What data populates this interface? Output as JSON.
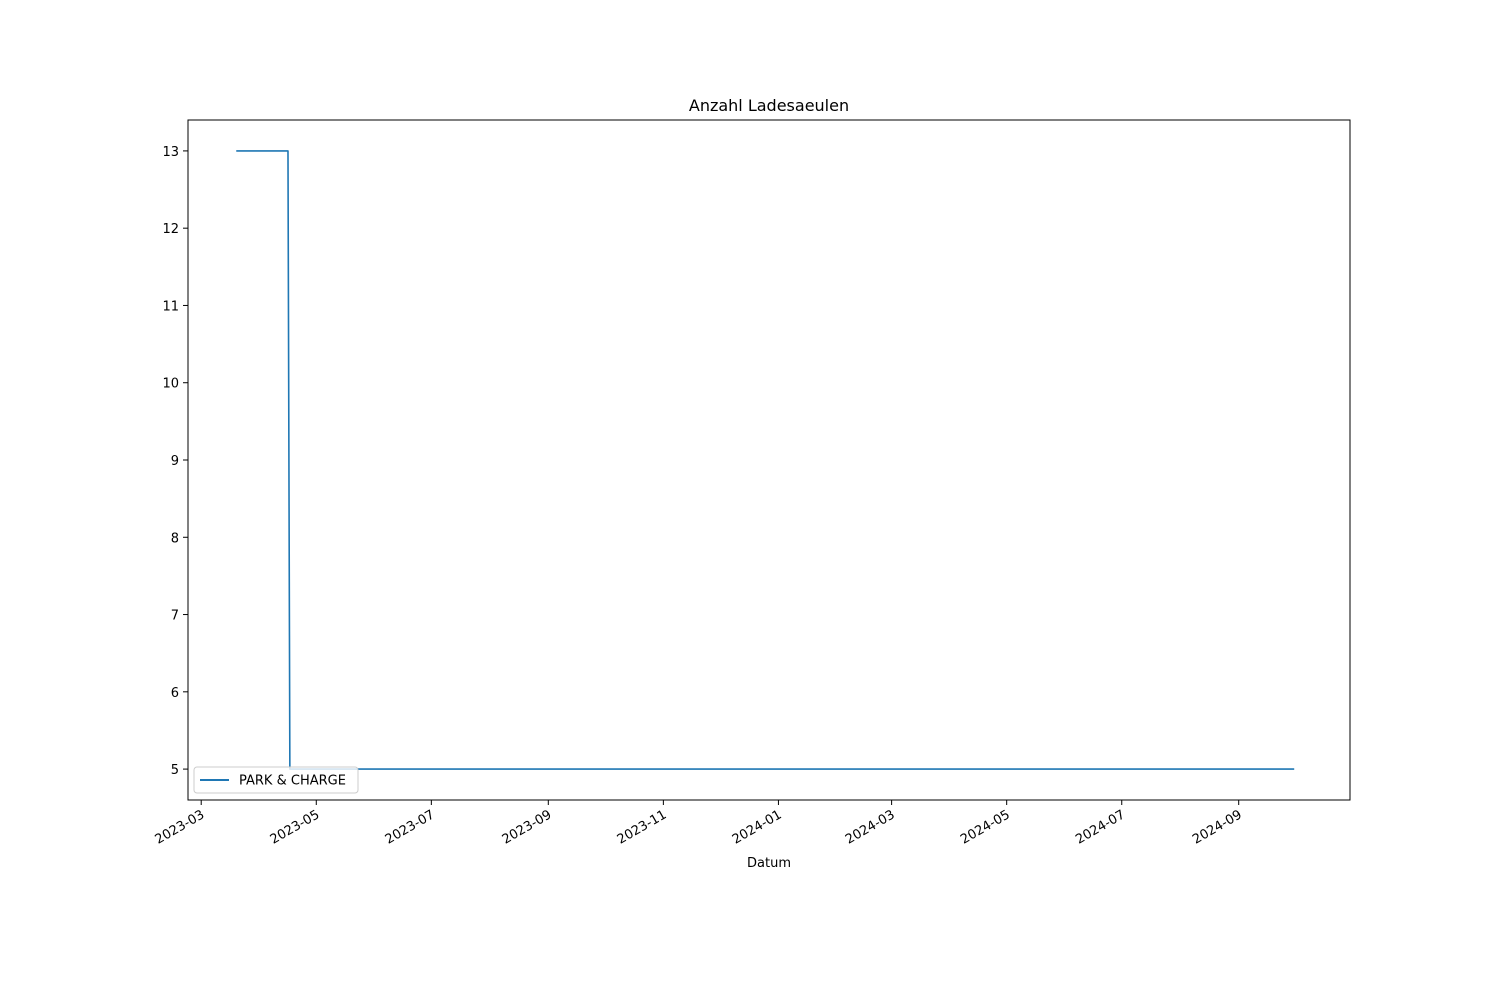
{
  "chart_data": {
    "type": "line",
    "title": "Anzahl Ladesaeulen",
    "xlabel": "Datum",
    "ylabel": "",
    "x_type": "date",
    "xlim": [
      "2023-02-22",
      "2024-10-30"
    ],
    "ylim": [
      4.6,
      13.4
    ],
    "x_ticks": [
      "2023-03-01",
      "2023-05-01",
      "2023-07-01",
      "2023-09-01",
      "2023-11-01",
      "2024-01-01",
      "2024-03-01",
      "2024-05-01",
      "2024-07-01",
      "2024-09-01"
    ],
    "x_tick_labels": [
      "2023-03",
      "2023-05",
      "2023-07",
      "2023-09",
      "2023-11",
      "2024-01",
      "2024-03",
      "2024-05",
      "2024-07",
      "2024-09"
    ],
    "y_ticks": [
      5,
      6,
      7,
      8,
      9,
      10,
      11,
      12,
      13
    ],
    "y_tick_labels": [
      "5",
      "6",
      "7",
      "8",
      "9",
      "10",
      "11",
      "12",
      "13"
    ],
    "grid": false,
    "legend_position": "lower-left",
    "series": [
      {
        "name": "PARK & CHARGE",
        "color": "#1f77b4",
        "points": [
          {
            "x": "2023-03-20",
            "y": 13
          },
          {
            "x": "2023-04-16",
            "y": 13
          },
          {
            "x": "2023-04-17",
            "y": 5
          },
          {
            "x": "2024-09-30",
            "y": 5
          }
        ]
      }
    ]
  }
}
